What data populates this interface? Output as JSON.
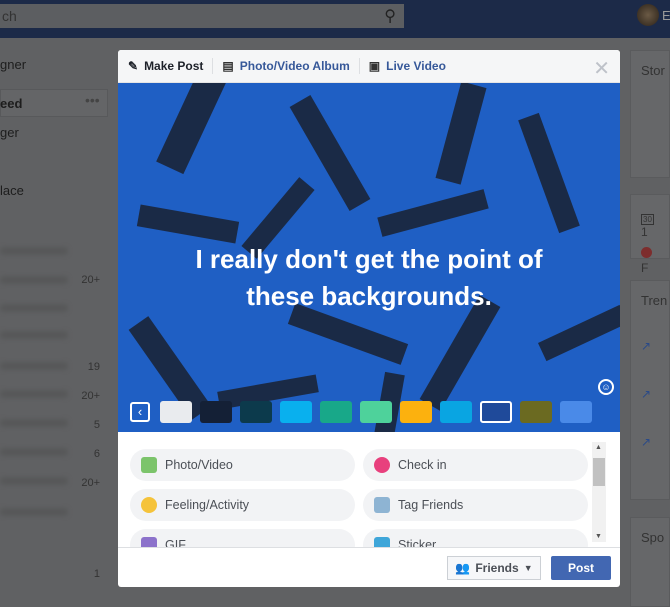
{
  "topbar": {
    "search_text": "ch",
    "user_initial": "E"
  },
  "sidebar": {
    "items": [
      "gner",
      "eed",
      "ger",
      "lace"
    ],
    "counts": [
      "20+",
      "19",
      "20+",
      "5",
      "6",
      "20+",
      "1"
    ]
  },
  "right_column": {
    "stories": "Stor",
    "event": "1",
    "event_date": "30",
    "birthday": "F",
    "trending": "Tren",
    "sponsored": "Spo"
  },
  "modal": {
    "tabs": [
      {
        "label": "Make Post",
        "icon": "pencil-icon"
      },
      {
        "label": "Photo/Video Album",
        "icon": "album-icon"
      },
      {
        "label": "Live Video",
        "icon": "video-camera-icon"
      }
    ],
    "post_text": [
      "I really don't get the point of",
      "these backgrounds."
    ],
    "swatches": [
      "#e9ebee",
      "#142036",
      "#0c3a4c",
      "#09b0ee",
      "#18a889",
      "#4ed29b",
      "#fcb10e",
      "#09a5e2",
      "#1f4a9a",
      "#6b6a21",
      "#4a8ae8"
    ],
    "selected_swatch": 8,
    "options": [
      {
        "label": "Photo/Video",
        "icon": "photo-icon",
        "color": "#7cc46b"
      },
      {
        "label": "Check in",
        "icon": "location-pin-icon",
        "color": "#e8407d"
      },
      {
        "label": "Feeling/Activity",
        "icon": "smiley-icon",
        "color": "#f5c33b"
      },
      {
        "label": "Tag Friends",
        "icon": "tag-friends-icon",
        "color": "#8eb4d3"
      },
      {
        "label": "GIF",
        "icon": "gif-icon",
        "color": "#8c72cb"
      },
      {
        "label": "Sticker",
        "icon": "sticker-icon",
        "color": "#3fa6d9"
      }
    ],
    "audience": "Friends",
    "post_label": "Post",
    "accent": "#4267b2"
  }
}
